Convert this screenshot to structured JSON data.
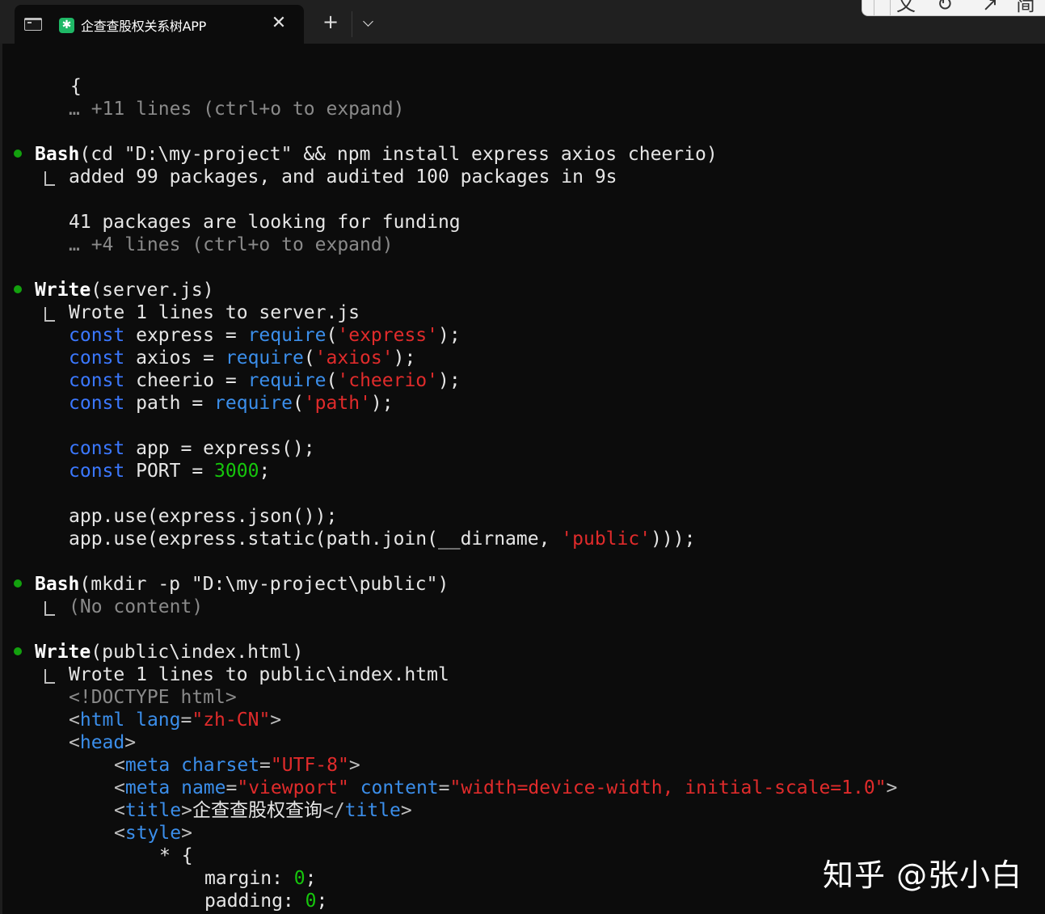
{
  "tab": {
    "title": "企查查股权关系树APP",
    "app_icon_glyph": "✱",
    "close_glyph": "✕",
    "new_tab_glyph": "+"
  },
  "overlay_toolbar": {
    "items": [
      "文",
      "↻",
      "↗",
      "简"
    ]
  },
  "terminal": {
    "lines": {
      "l01": "{",
      "l02": "… +11 lines (ctrl+o to expand)",
      "l03_cmd": "Bash",
      "l03_args": "(cd \"D:\\my-project\" && npm install express axios cheerio)",
      "l04": "added 99 packages, and audited 100 packages in 9s",
      "l05": "41 packages are looking for funding",
      "l06": "… +4 lines (ctrl+o to expand)",
      "l07_cmd": "Write",
      "l07_args": "(server.js)",
      "l08": "Wrote 1 lines to server.js",
      "l09": {
        "k": "const",
        "a": " express = ",
        "f": "require",
        "p1": "(",
        "s": "'express'",
        "p2": ");"
      },
      "l10": {
        "k": "const",
        "a": " axios = ",
        "f": "require",
        "p1": "(",
        "s": "'axios'",
        "p2": ");"
      },
      "l11": {
        "k": "const",
        "a": " cheerio = ",
        "f": "require",
        "p1": "(",
        "s": "'cheerio'",
        "p2": ");"
      },
      "l12": {
        "k": "const",
        "a": " path = ",
        "f": "require",
        "p1": "(",
        "s": "'path'",
        "p2": ");"
      },
      "l13": {
        "k": "const",
        "a": " app = express();"
      },
      "l14": {
        "k": "const",
        "a": " PORT = ",
        "n": "3000",
        "e": ";"
      },
      "l15": "app.use(express.json());",
      "l16": {
        "a": "app.use(express.static(path.join(__dirname, ",
        "s": "'public'",
        "e": ")));"
      },
      "l17_cmd": "Bash",
      "l17_args": "(mkdir -p \"D:\\my-project\\public\")",
      "l18": "(No content)",
      "l19_cmd": "Write",
      "l19_args": "(public\\index.html)",
      "l20": "Wrote 1 lines to public\\index.html",
      "l21": "<!DOCTYPE html>",
      "l22": {
        "o": "<",
        "t": "html",
        "sp": " ",
        "at": "lang",
        "eq": "=",
        "v": "\"zh-CN\"",
        "c": ">"
      },
      "l23": {
        "o": "<",
        "t": "head",
        "c": ">"
      },
      "l24": {
        "o": "<",
        "t": "meta",
        "sp": " ",
        "at": "charset",
        "eq": "=",
        "v": "\"UTF-8\"",
        "c": ">"
      },
      "l25": {
        "o": "<",
        "t": "meta",
        "sp": " ",
        "at": "name",
        "eq": "=",
        "v": "\"viewport\"",
        "sp2": " ",
        "at2": "content",
        "eq2": "=",
        "v2": "\"width=device-width, initial-scale=1.0\"",
        "c": ">"
      },
      "l26": {
        "o": "<",
        "t": "title",
        "c1": ">",
        "txt": "企查查股权查询",
        "o2": "</",
        "t2": "title",
        "c": ">"
      },
      "l27": {
        "o": "<",
        "t": "style",
        "c": ">"
      },
      "l28": "* {",
      "l29": {
        "a": "margin: ",
        "n": "0",
        "e": ";"
      },
      "l30": {
        "a": "padding: ",
        "n": "0",
        "e": ";"
      }
    }
  },
  "watermark": "知乎 @张小白",
  "colors": {
    "background": "#0c0c0c",
    "bullet_green": "#13a10e",
    "keyword_blue": "#3b78ff",
    "string_red": "#e02b2b",
    "number_green": "#16c60c"
  }
}
